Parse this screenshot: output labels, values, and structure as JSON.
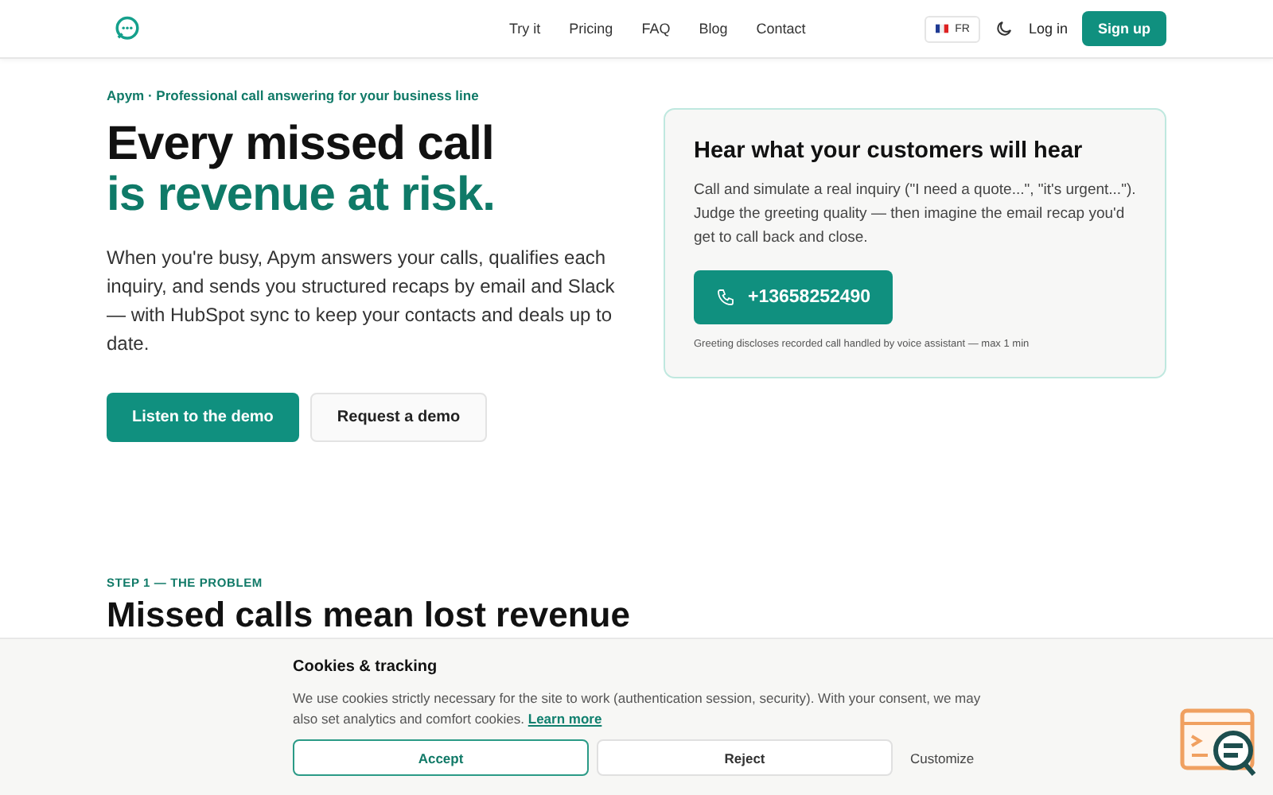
{
  "nav": {
    "links": [
      "Try it",
      "Pricing",
      "FAQ",
      "Blog",
      "Contact"
    ],
    "language": "FR",
    "login": "Log in",
    "signup": "Sign up"
  },
  "hero": {
    "eyebrow": "Apym · Professional call answering for your business line",
    "title_line_1": "Every missed call",
    "title_line_2": "is revenue at risk.",
    "description": "When you're busy, Apym answers your calls, qualifies each inquiry, and sends you structured recaps by email and Slack — with HubSpot sync to keep your contacts and deals up to date.",
    "buttons": [
      "Listen to the demo",
      "Request a demo"
    ]
  },
  "demo_card": {
    "title": "Hear what your customers will hear",
    "text": "Call and simulate a real inquiry (\"I need a quote...\", \"it's urgent...\"). Judge the greeting quality — then imagine the email recap you'd get to call back and close.",
    "phone": "+13658252490",
    "note": "Greeting discloses recorded call handled by voice assistant — max 1 min"
  },
  "section": {
    "eyebrow": "STEP 1 — THE PROBLEM",
    "title": "Missed calls mean lost revenue"
  },
  "cookie_banner": {
    "title": "Cookies & tracking",
    "text": "We use cookies strictly necessary for the site to work (authentication session, security). With your consent, we may also set analytics and comfort cookies.",
    "link": "Learn more",
    "buttons": [
      "Accept",
      "Reject",
      "Customize"
    ]
  }
}
